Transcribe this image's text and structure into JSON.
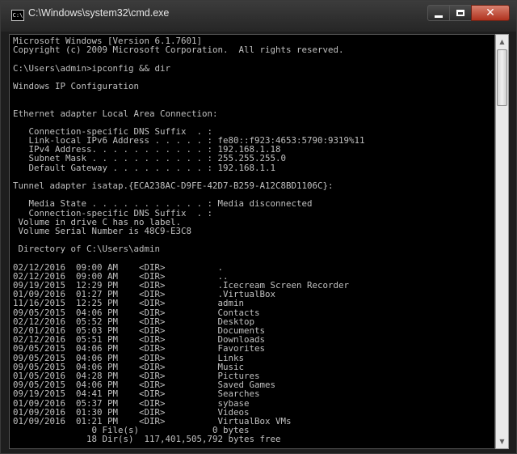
{
  "window": {
    "title": "C:\\Windows\\system32\\cmd.exe",
    "icon_label": "C:\\",
    "controls": {
      "minimize": "minimize-icon",
      "maximize": "maximize-icon",
      "close": "close-icon"
    }
  },
  "console": {
    "lines": [
      "Microsoft Windows [Version 6.1.7601]",
      "Copyright (c) 2009 Microsoft Corporation.  All rights reserved.",
      "",
      "C:\\Users\\admin>ipconfig && dir",
      "",
      "Windows IP Configuration",
      "",
      "",
      "Ethernet adapter Local Area Connection:",
      "",
      "   Connection-specific DNS Suffix  . :",
      "   Link-local IPv6 Address . . . . . : fe80::f923:4653:5790:9319%11",
      "   IPv4 Address. . . . . . . . . . . : 192.168.1.18",
      "   Subnet Mask . . . . . . . . . . . : 255.255.255.0",
      "   Default Gateway . . . . . . . . . : 192.168.1.1",
      "",
      "Tunnel adapter isatap.{ECA238AC-D9FE-42D7-B259-A12C8BD1106C}:",
      "",
      "   Media State . . . . . . . . . . . : Media disconnected",
      "   Connection-specific DNS Suffix  . :",
      " Volume in drive C has no label.",
      " Volume Serial Number is 48C9-E3C8",
      "",
      " Directory of C:\\Users\\admin",
      "",
      "02/12/2016  09:00 AM    <DIR>          .",
      "02/12/2016  09:00 AM    <DIR>          ..",
      "09/19/2015  12:29 PM    <DIR>          .Icecream Screen Recorder",
      "01/09/2016  01:27 PM    <DIR>          .VirtualBox",
      "11/16/2015  12:25 PM    <DIR>          admin",
      "09/05/2015  04:06 PM    <DIR>          Contacts",
      "02/12/2016  05:52 PM    <DIR>          Desktop",
      "02/01/2016  05:03 PM    <DIR>          Documents",
      "02/12/2016  05:51 PM    <DIR>          Downloads",
      "09/05/2015  04:06 PM    <DIR>          Favorites",
      "09/05/2015  04:06 PM    <DIR>          Links",
      "09/05/2015  04:06 PM    <DIR>          Music",
      "01/05/2016  04:28 PM    <DIR>          Pictures",
      "09/05/2015  04:06 PM    <DIR>          Saved Games",
      "09/19/2015  04:41 PM    <DIR>          Searches",
      "01/09/2016  05:37 PM    <DIR>          sybase",
      "01/09/2016  01:30 PM    <DIR>          Videos",
      "01/09/2016  01:21 PM    <DIR>          VirtualBox VMs",
      "               0 File(s)              0 bytes",
      "              18 Dir(s)  117,401,505,792 bytes free"
    ]
  },
  "scrollbar": {
    "up": "scroll-up-arrow-icon",
    "down": "scroll-down-arrow-icon"
  }
}
